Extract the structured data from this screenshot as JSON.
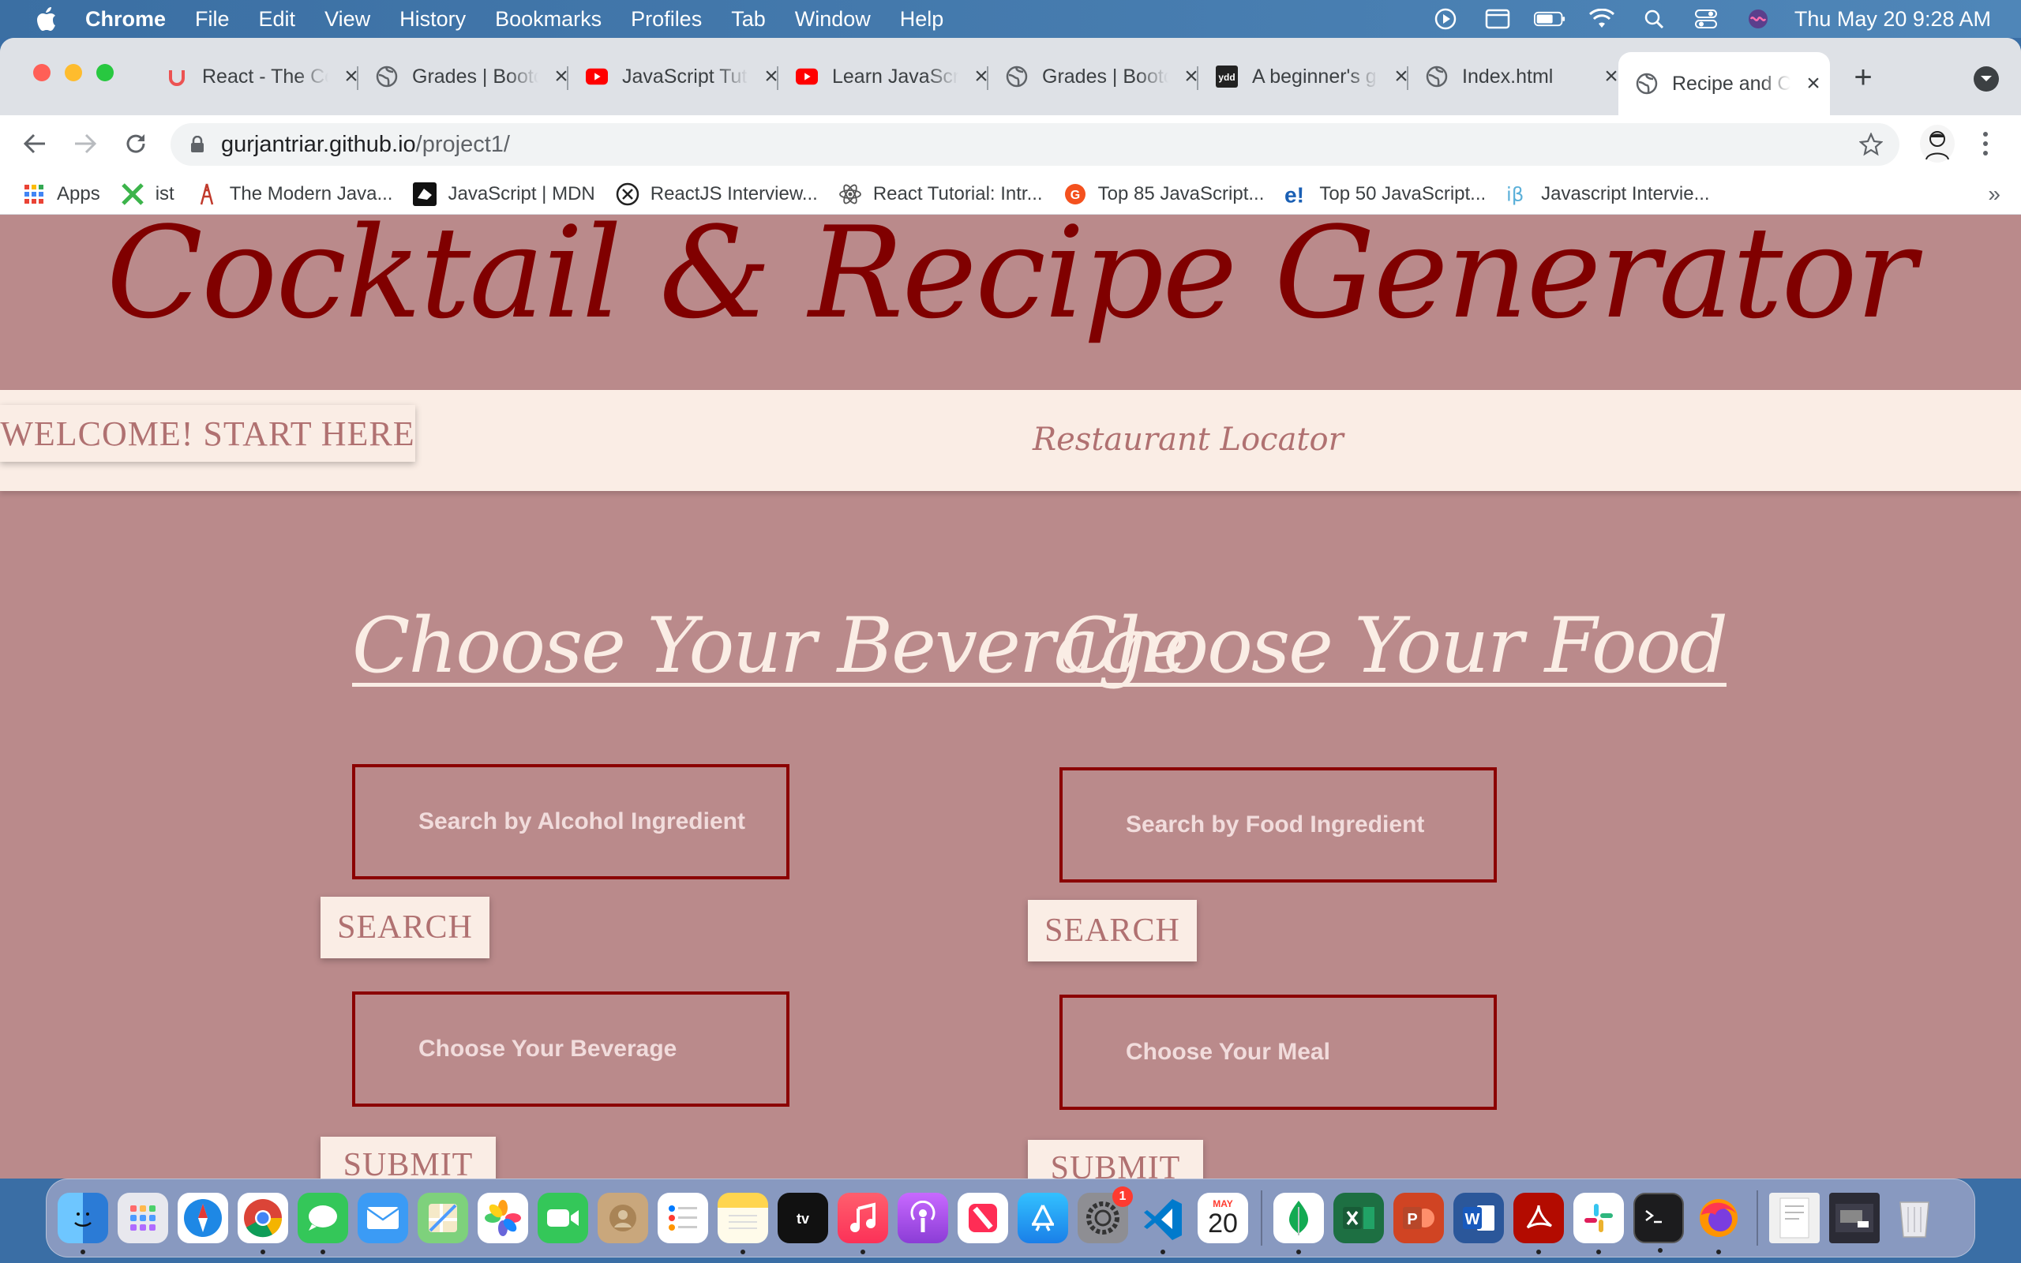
{
  "menubar": {
    "app": "Chrome",
    "items": [
      "File",
      "Edit",
      "View",
      "History",
      "Bookmarks",
      "Profiles",
      "Tab",
      "Window",
      "Help"
    ],
    "clock": "Thu May 20  9:28 AM"
  },
  "tabs": [
    {
      "title": "React - The Complete Guide",
      "icon": "udemy-icon"
    },
    {
      "title": "Grades | Bootcamp",
      "icon": "globe-icon"
    },
    {
      "title": "JavaScript Tutorial",
      "icon": "youtube-icon"
    },
    {
      "title": "Learn JavaScript",
      "icon": "youtube-icon"
    },
    {
      "title": "Grades | Bootcamp",
      "icon": "globe-icon"
    },
    {
      "title": "A beginner's guide",
      "icon": "medium-icon"
    },
    {
      "title": "Index.html",
      "icon": "globe-icon"
    },
    {
      "title": "Recipe and Cocktail",
      "icon": "globe-icon",
      "active": true
    }
  ],
  "omnibox": {
    "host": "gurjantriar.github.io",
    "path": "/project1/"
  },
  "bookmarks": [
    {
      "label": "Apps",
      "icon": "apps-grid-icon"
    },
    {
      "label": "ist",
      "icon": "x-logo-icon"
    },
    {
      "label": "The Modern Java...",
      "icon": "tower-icon"
    },
    {
      "label": "JavaScript | MDN",
      "icon": "mdn-icon"
    },
    {
      "label": "ReactJS Interview...",
      "icon": "x-circle-icon"
    },
    {
      "label": "React Tutorial: Intr...",
      "icon": "react-icon"
    },
    {
      "label": "Top 85 JavaScript...",
      "icon": "orange-logo-icon"
    },
    {
      "label": "Top 50 JavaScript...",
      "icon": "e-logo-icon"
    },
    {
      "label": "Javascript Intervie...",
      "icon": "ib-logo-icon"
    }
  ],
  "page": {
    "title": "Cocktail & Recipe Generator",
    "nav": {
      "welcome": "WELCOME! START HERE",
      "restaurant": "Restaurant Locator"
    },
    "beverage": {
      "heading": "Choose Your Beverage",
      "search_placeholder": "Search by Alcohol Ingredient",
      "search_btn": "SEARCH",
      "choose_placeholder": "Choose Your Beverage",
      "submit_btn": "SUBMIT"
    },
    "food": {
      "heading": "Choose Your Food",
      "search_placeholder": "Search by Food Ingredient",
      "search_btn": "SEARCH",
      "choose_placeholder": "Choose Your Meal",
      "submit_btn": "SUBMIT"
    }
  },
  "dock": {
    "calendar": {
      "month": "MAY",
      "day": "20"
    },
    "settings_badge": "1",
    "apps": [
      "finder-icon",
      "launchpad-icon",
      "safari-icon",
      "chrome-icon",
      "messages-icon",
      "mail-icon",
      "maps-icon",
      "photos-icon",
      "facetime-icon",
      "contacts-icon",
      "reminders-icon",
      "notes-icon",
      "appletv-icon",
      "music-icon",
      "podcasts-icon",
      "news-icon",
      "appstore-icon",
      "settings-icon",
      "vscode-icon",
      "calendar-icon",
      "mongodb-icon",
      "excel-icon",
      "powerpoint-icon",
      "word-icon",
      "acrobat-icon",
      "slack-icon",
      "terminal-icon",
      "firefox-icon",
      "downloads-icon",
      "screenshot-icon",
      "trash-icon"
    ]
  },
  "colors": {
    "page_bg": "#ba8a8b",
    "title": "#800000",
    "band": "#faede5",
    "btn_text": "#b07171",
    "field_border": "#8b0000"
  }
}
